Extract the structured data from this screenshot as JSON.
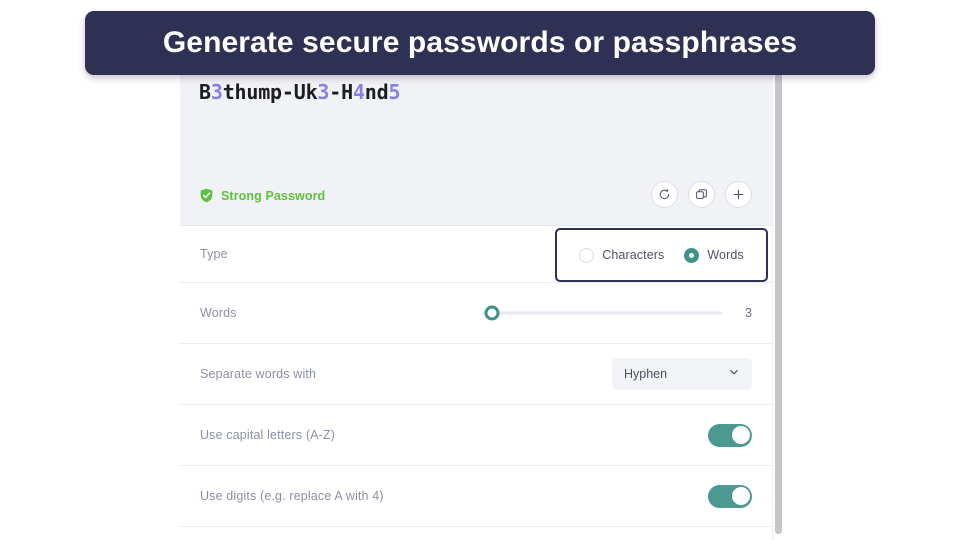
{
  "banner": {
    "text": "Generate secure passwords or passphrases",
    "background_color": "#2e3154",
    "text_color": "#ffffff"
  },
  "generator": {
    "password": {
      "full_text": "B3thump-Uk3-H4nd5",
      "segments": [
        {
          "text": "B",
          "kind": "letter"
        },
        {
          "text": "3",
          "kind": "digit"
        },
        {
          "text": "thump-Uk",
          "kind": "letter"
        },
        {
          "text": "3",
          "kind": "digit"
        },
        {
          "text": "-H",
          "kind": "letter"
        },
        {
          "text": "4",
          "kind": "digit"
        },
        {
          "text": "nd",
          "kind": "letter"
        },
        {
          "text": "5",
          "kind": "digit"
        }
      ],
      "digit_color": "#8b7df0",
      "letter_color": "#1d1d24"
    },
    "strength": {
      "label": "Strong Password",
      "color": "#5ec23f",
      "icon": "shield-check-icon"
    },
    "actions": [
      {
        "name": "regenerate",
        "icon": "refresh-icon"
      },
      {
        "name": "copy",
        "icon": "copy-icon"
      },
      {
        "name": "add",
        "icon": "plus-icon"
      }
    ],
    "settings": {
      "type": {
        "label": "Type",
        "options": [
          {
            "label": "Characters",
            "selected": false
          },
          {
            "label": "Words",
            "selected": true
          }
        ],
        "selected_color": "#3f9287",
        "highlight_border_color": "#2e3154"
      },
      "words": {
        "label": "Words",
        "value": "3",
        "min": "1",
        "max": "10",
        "accent_color": "#3f9287"
      },
      "separator": {
        "label": "Separate words with",
        "value": "Hyphen"
      },
      "capitals": {
        "label": "Use capital letters (A-Z)",
        "enabled": true
      },
      "digits": {
        "label": "Use digits (e.g. replace A with 4)",
        "enabled": true
      }
    }
  }
}
